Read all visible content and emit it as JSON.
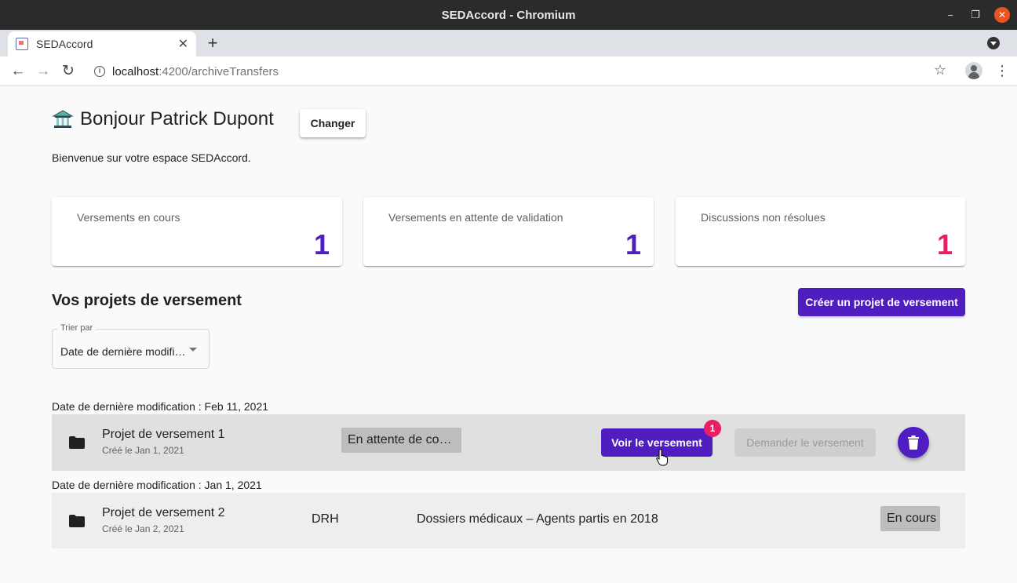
{
  "window": {
    "title": "SEDAccord - Chromium",
    "min": "−",
    "max": "❐",
    "close": "✕"
  },
  "tab": {
    "title": "SEDAccord",
    "close": "✕",
    "new": "+"
  },
  "addressbar": {
    "host": "localhost",
    "path": ":4200/archiveTransfers",
    "info": "i",
    "star": "☆",
    "menu": "⋮"
  },
  "nav": {
    "back": "←",
    "forward": "→",
    "reload": "↻"
  },
  "header": {
    "greeting": "Bonjour Patrick Dupont",
    "change_label": "Changer",
    "welcome": "Bienvenue sur votre espace SEDAccord."
  },
  "stats": [
    {
      "label": "Versements en cours",
      "value": "1",
      "color": "#4f1dc0"
    },
    {
      "label": "Versements en attente de validation",
      "value": "1",
      "color": "#4f1dc0"
    },
    {
      "label": "Discussions non résolues",
      "value": "1",
      "color": "#e91e63"
    }
  ],
  "projects": {
    "title": "Vos projets de versement",
    "create_label": "Créer un projet de versement",
    "sort": {
      "label": "Trier par",
      "value": "Date de dernière modification"
    },
    "groups": [
      {
        "label": "Date de dernière modification : Feb 11, 2021",
        "item": {
          "name": "Projet de versement 1",
          "created": "Créé le Jan 1, 2021",
          "status": "En attente de corrections",
          "view_label": "Voir le versement",
          "badge": "1",
          "request_label": "Demander le versement"
        }
      },
      {
        "label": "Date de dernière modification : Jan 1, 2021",
        "item": {
          "name": "Projet de versement 2",
          "created": "Créé le Jan 2, 2021",
          "service": "DRH",
          "description": "Dossiers médicaux – Agents partis en 2018",
          "status": "En cours"
        }
      }
    ]
  },
  "colors": {
    "primary": "#4f1dc0",
    "accent": "#e91e63"
  }
}
